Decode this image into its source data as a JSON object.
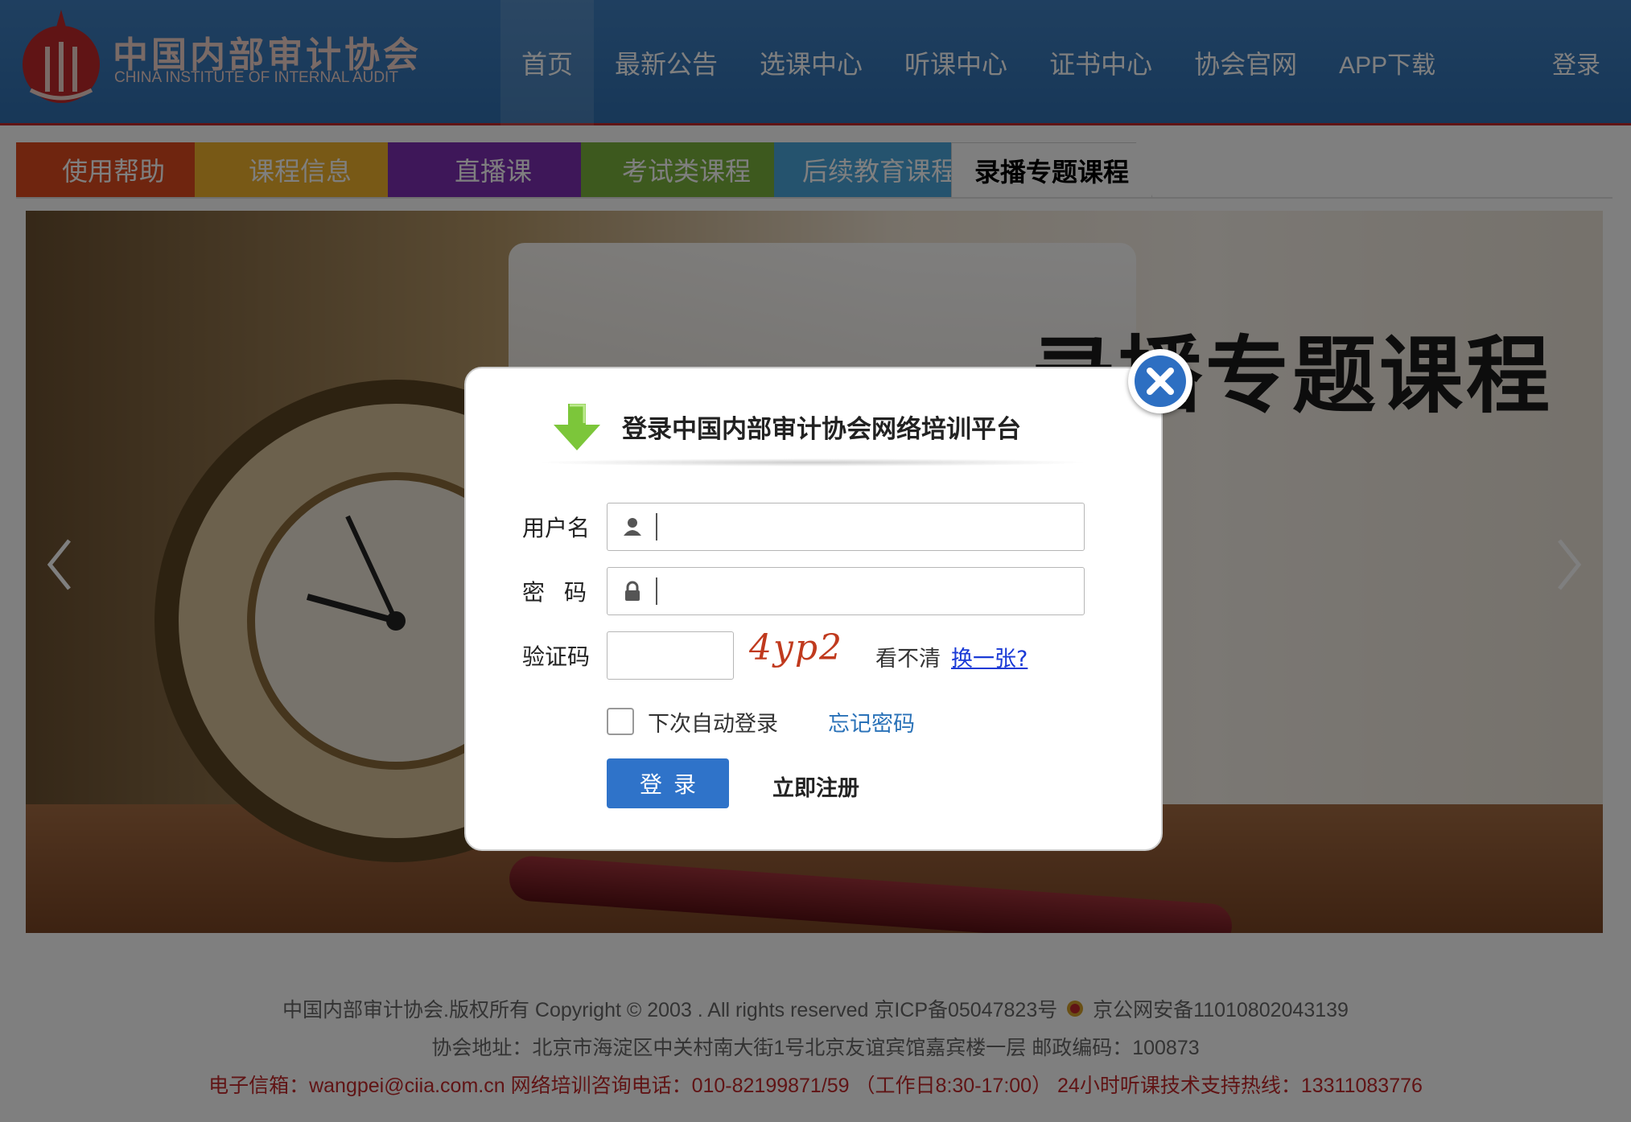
{
  "header": {
    "logo_cn": "中国内部审计协会",
    "logo_en": "CHINA INSTITUTE OF INTERNAL AUDIT",
    "nav": [
      "首页",
      "最新公告",
      "选课中心",
      "听课中心",
      "证书中心",
      "协会官网",
      "APP下载"
    ],
    "login": "登录"
  },
  "tabs": [
    "使用帮助",
    "课程信息",
    "直播课",
    "考试类课程",
    "后续教育课程",
    "录播专题课程"
  ],
  "banner": {
    "title": "录播专题课程"
  },
  "modal": {
    "title": "登录中国内部审计协会网络培训平台",
    "username_label": "用户名",
    "password_label": "密码",
    "captcha_label": "验证码",
    "captcha_text": "4yp2",
    "captcha_hint": "看不清",
    "captcha_change": "换一张? ",
    "remember_label": "下次自动登录",
    "forgot_label": "忘记密码",
    "login_button": "登录",
    "register_label": "立即注册",
    "username_value": "",
    "password_value": "",
    "captcha_value": ""
  },
  "footer": {
    "line1_a": "中国内部审计协会.版权所有    Copyright © 2003 . All rights reserved    京ICP备05047823号",
    "line1_b": "京公网安备11010802043139",
    "line2": "协会地址：北京市海淀区中关村南大街1号北京友谊宾馆嘉宾楼一层    邮政编码：100873",
    "line3": "电子信箱：wangpei@ciia.com.cn    网络培训咨询电话：010-82199871/59  （工作日8:30-17:00）    24小时听课技术支持热线：13311083776"
  },
  "colors": {
    "header_bg": "#3578b8",
    "accent_red": "#c0282a",
    "button_blue": "#2f73c9",
    "link_blue": "#2a72b8"
  },
  "icons": [
    "logo-emblem-icon",
    "down-arrow-icon",
    "user-icon",
    "lock-icon",
    "close-icon",
    "chevron-left-icon",
    "chevron-right-icon",
    "police-badge-icon"
  ]
}
